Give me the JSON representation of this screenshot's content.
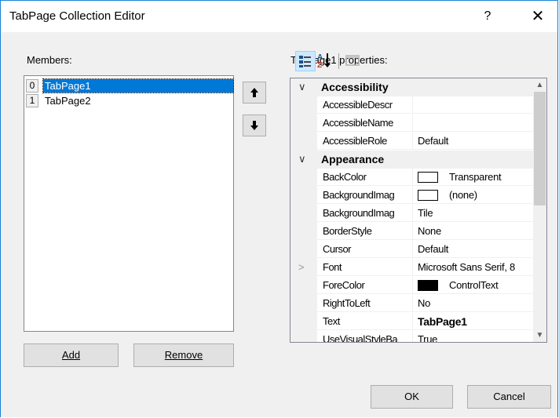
{
  "window": {
    "title": "TabPage Collection Editor",
    "help_glyph": "?",
    "close_glyph": "✕"
  },
  "members": {
    "label": "Members:",
    "items": [
      {
        "index": "0",
        "name": "TabPage1",
        "selected": true
      },
      {
        "index": "1",
        "name": "TabPage2",
        "selected": false
      }
    ],
    "move_up_glyph": "🡅",
    "move_down_glyph": "🡇",
    "add_label": "Add",
    "remove_label": "Remove"
  },
  "properties": {
    "label": "TabPage1 properties:",
    "toolbar": {
      "categorized_icon": "categorized-icon",
      "alphabetical_icon": "alphabetical-icon",
      "property_pages_icon": "property-pages-icon"
    },
    "rows": [
      {
        "type": "category",
        "name": "Accessibility",
        "expanded": true
      },
      {
        "type": "prop",
        "name": "AccessibleDescr",
        "value": ""
      },
      {
        "type": "prop",
        "name": "AccessibleName",
        "value": ""
      },
      {
        "type": "prop",
        "name": "AccessibleRole",
        "value": "Default"
      },
      {
        "type": "category",
        "name": "Appearance",
        "expanded": true
      },
      {
        "type": "prop",
        "name": "BackColor",
        "value": "Transparent",
        "swatch": "#ffffff"
      },
      {
        "type": "prop",
        "name": "BackgroundImag",
        "value": "(none)",
        "swatch": "#ffffff"
      },
      {
        "type": "prop",
        "name": "BackgroundImag",
        "value": "Tile"
      },
      {
        "type": "prop",
        "name": "BorderStyle",
        "value": "None"
      },
      {
        "type": "prop",
        "name": "Cursor",
        "value": "Default"
      },
      {
        "type": "prop",
        "name": "Font",
        "value": "Microsoft Sans Serif, 8",
        "expandable": true
      },
      {
        "type": "prop",
        "name": "ForeColor",
        "value": "ControlText",
        "swatch": "#000000"
      },
      {
        "type": "prop",
        "name": "RightToLeft",
        "value": "No"
      },
      {
        "type": "prop",
        "name": "Text",
        "value": "TabPage1",
        "bold": true
      },
      {
        "type": "prop",
        "name": "UseVisualStyleBa",
        "value": "True"
      }
    ]
  },
  "footer": {
    "ok_label": "OK",
    "cancel_label": "Cancel"
  },
  "colors": {
    "accent": "#0078d7",
    "border": "#1883d7",
    "panel": "#f0f0f0"
  }
}
